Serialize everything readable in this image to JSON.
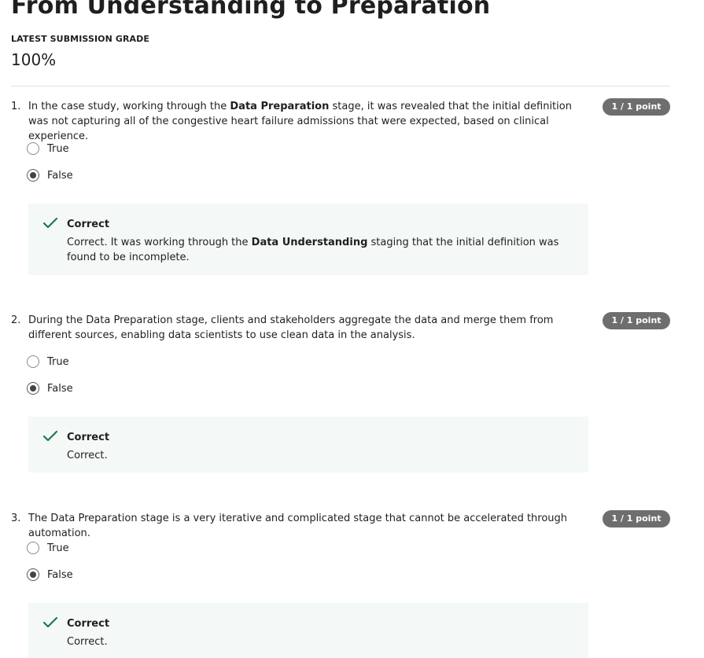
{
  "page": {
    "title": "From Understanding to Preparation",
    "grade_label": "LATEST SUBMISSION GRADE",
    "grade_value": "100%"
  },
  "questions": [
    {
      "number": "1.",
      "text_parts": [
        "In the case study, working through the ",
        "Data Preparation",
        " stage, it was revealed that the initial definition was not capturing all of the congestive heart failure admissions that were expected, based on clinical experience."
      ],
      "points": "1 / 1 point",
      "options": [
        {
          "label": "True",
          "selected": false
        },
        {
          "label": "False",
          "selected": true
        }
      ],
      "feedback": {
        "title": "Correct",
        "text_parts": [
          "Correct. It was working through the ",
          "Data Understanding",
          " staging that the initial definition was found to be incomplete."
        ]
      }
    },
    {
      "number": "2.",
      "text": "During the Data Preparation stage, clients and stakeholders aggregate the data and merge them from different sources, enabling data scientists to use clean data in the analysis.",
      "points": "1 / 1 point",
      "options": [
        {
          "label": "True",
          "selected": false
        },
        {
          "label": "False",
          "selected": true
        }
      ],
      "feedback": {
        "title": "Correct",
        "text": "Correct."
      }
    },
    {
      "number": "3.",
      "text": "The Data Preparation stage is a very iterative and complicated stage that cannot be accelerated through automation.",
      "points": "1 / 1 point",
      "options": [
        {
          "label": "True",
          "selected": false
        },
        {
          "label": "False",
          "selected": true
        }
      ],
      "feedback": {
        "title": "Correct",
        "text": "Correct."
      }
    }
  ],
  "colors": {
    "badge_bg": "#6e6e6e",
    "feedback_bg": "#f4f8f6",
    "check_green": "#1e7a4a"
  },
  "icons": {
    "radio_unselected": "radio-unselected-icon",
    "radio_selected": "radio-selected-icon",
    "check": "check-icon"
  }
}
